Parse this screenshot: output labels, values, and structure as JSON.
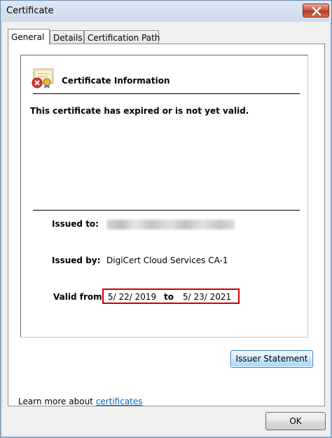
{
  "window": {
    "title": "Certificate",
    "close_icon": "close-icon"
  },
  "tabs": [
    {
      "label": "General",
      "active": true
    },
    {
      "label": "Details",
      "active": false
    },
    {
      "label": "Certification Path",
      "active": false
    }
  ],
  "general": {
    "info_title": "Certificate Information",
    "info_icon": "certificate-error-icon",
    "warning": "This certificate has expired or is not yet valid.",
    "issued_to_label": "Issued to:",
    "issued_by_label": "Issued by:",
    "issued_by_value": "DigiCert Cloud Services CA-1",
    "valid_from_label": "Valid from",
    "valid_from_date": "5/ 22/ 2019",
    "valid_to_word": "to",
    "valid_to_date": "5/ 23/ 2021",
    "issuer_statement_button": "Issuer Statement",
    "learn_more_prefix": "Learn more about",
    "learn_more_link": "certificates"
  },
  "footer": {
    "ok_button": "OK"
  },
  "colors": {
    "highlight_border": "#d00000",
    "link": "#0066cc",
    "close_button": "#c8513c"
  }
}
